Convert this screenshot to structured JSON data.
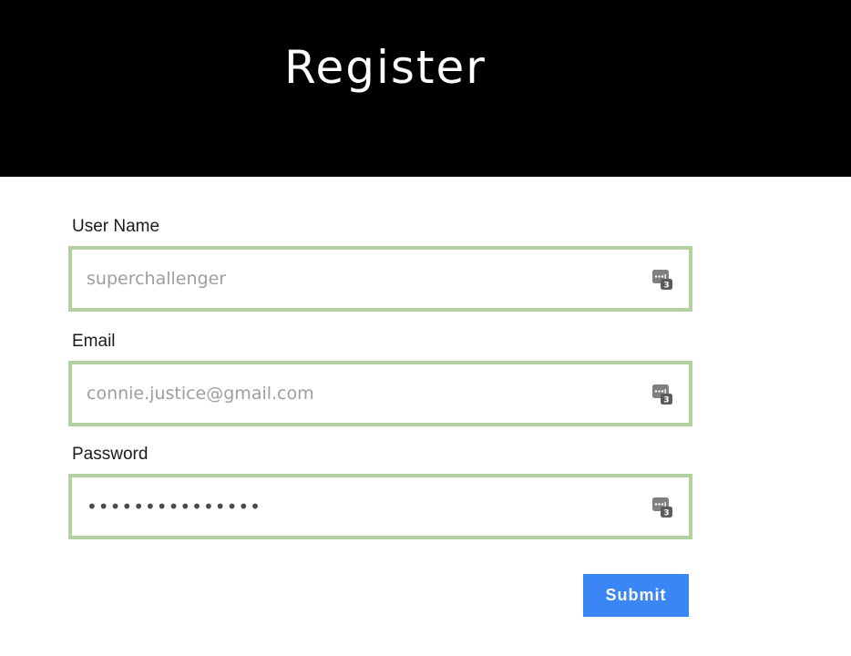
{
  "header": {
    "title": "Register"
  },
  "form": {
    "username": {
      "label": "User Name",
      "placeholder": "superchallenger",
      "value": ""
    },
    "email": {
      "label": "Email",
      "placeholder": "connie.justice@gmail.com",
      "value": ""
    },
    "password": {
      "label": "Password",
      "value": "•••••••••••••••"
    },
    "submit_label": "Submit",
    "password_manager_icon": "password-manager-icon",
    "password_manager_badge": "3"
  },
  "colors": {
    "header_bg": "#000000",
    "field_border": "#b1d29f",
    "submit_bg": "#3a86f5"
  }
}
